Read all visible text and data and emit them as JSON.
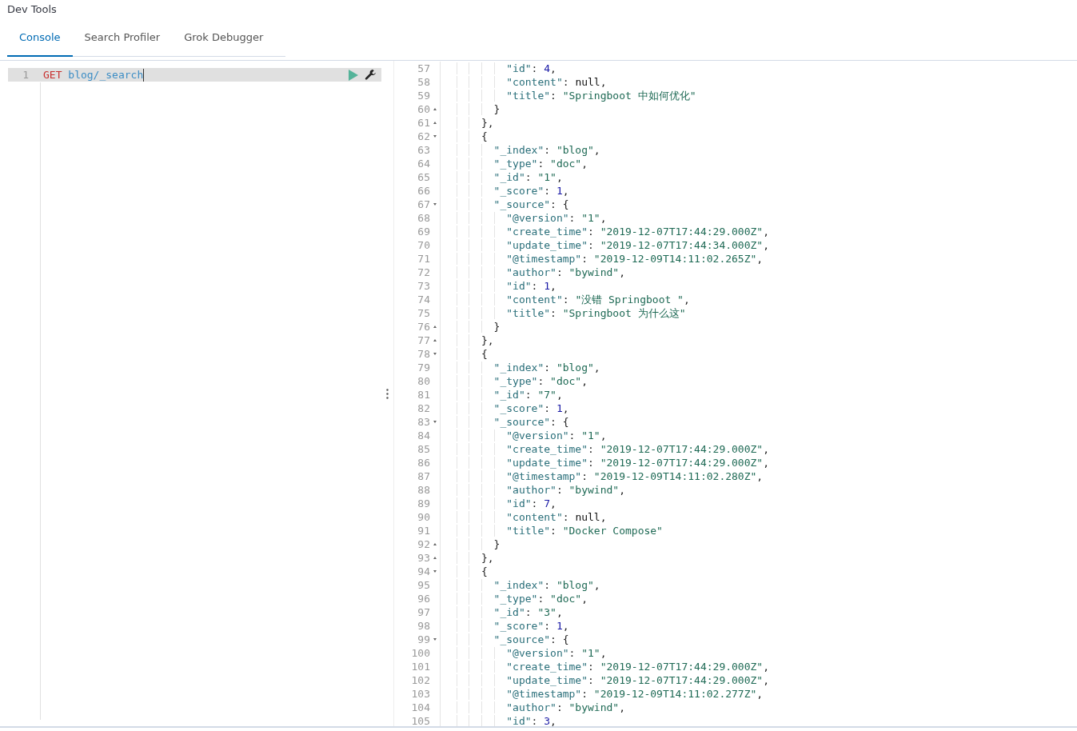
{
  "app": {
    "title": "Dev Tools"
  },
  "tabs": [
    {
      "label": "Console",
      "selected": true
    },
    {
      "label": "Search Profiler",
      "selected": false
    },
    {
      "label": "Grok Debugger",
      "selected": false
    }
  ],
  "request_editor": {
    "lines": [
      {
        "number": "1",
        "highlighted": true,
        "tokens": [
          {
            "kind": "method",
            "text": "GET "
          },
          {
            "kind": "url",
            "text": "blog/_search"
          }
        ]
      }
    ]
  },
  "response_viewer": {
    "lines": [
      {
        "number": "57",
        "kind": "plain",
        "tokens": [
          {
            "kind": "key",
            "text": "          \"id\""
          },
          {
            "kind": "punct",
            "text": ": "
          },
          {
            "kind": "number",
            "text": "4"
          },
          {
            "kind": "punct",
            "text": ","
          }
        ]
      },
      {
        "number": "58",
        "kind": "plain",
        "tokens": [
          {
            "kind": "key",
            "text": "          \"content\""
          },
          {
            "kind": "punct",
            "text": ": "
          },
          {
            "kind": "keyword",
            "text": "null"
          },
          {
            "kind": "punct",
            "text": ","
          }
        ]
      },
      {
        "number": "59",
        "kind": "plain",
        "tokens": [
          {
            "kind": "key",
            "text": "          \"title\""
          },
          {
            "kind": "punct",
            "text": ": "
          },
          {
            "kind": "string",
            "text": "\"Springboot 中如何优化\""
          }
        ]
      },
      {
        "number": "60",
        "kind": "closer",
        "tokens": [
          {
            "kind": "punct",
            "text": "        }"
          }
        ]
      },
      {
        "number": "61",
        "kind": "closer",
        "tokens": [
          {
            "kind": "punct",
            "text": "      },"
          }
        ]
      },
      {
        "number": "62",
        "kind": "opener",
        "tokens": [
          {
            "kind": "punct",
            "text": "      {"
          }
        ]
      },
      {
        "number": "63",
        "kind": "plain",
        "tokens": [
          {
            "kind": "key",
            "text": "        \"_index\""
          },
          {
            "kind": "punct",
            "text": ": "
          },
          {
            "kind": "string",
            "text": "\"blog\""
          },
          {
            "kind": "punct",
            "text": ","
          }
        ]
      },
      {
        "number": "64",
        "kind": "plain",
        "tokens": [
          {
            "kind": "key",
            "text": "        \"_type\""
          },
          {
            "kind": "punct",
            "text": ": "
          },
          {
            "kind": "string",
            "text": "\"doc\""
          },
          {
            "kind": "punct",
            "text": ","
          }
        ]
      },
      {
        "number": "65",
        "kind": "plain",
        "tokens": [
          {
            "kind": "key",
            "text": "        \"_id\""
          },
          {
            "kind": "punct",
            "text": ": "
          },
          {
            "kind": "string",
            "text": "\"1\""
          },
          {
            "kind": "punct",
            "text": ","
          }
        ]
      },
      {
        "number": "66",
        "kind": "plain",
        "tokens": [
          {
            "kind": "key",
            "text": "        \"_score\""
          },
          {
            "kind": "punct",
            "text": ": "
          },
          {
            "kind": "number",
            "text": "1"
          },
          {
            "kind": "punct",
            "text": ","
          }
        ]
      },
      {
        "number": "67",
        "kind": "opener",
        "tokens": [
          {
            "kind": "key",
            "text": "        \"_source\""
          },
          {
            "kind": "punct",
            "text": ": {"
          }
        ]
      },
      {
        "number": "68",
        "kind": "plain",
        "tokens": [
          {
            "kind": "key",
            "text": "          \"@version\""
          },
          {
            "kind": "punct",
            "text": ": "
          },
          {
            "kind": "string",
            "text": "\"1\""
          },
          {
            "kind": "punct",
            "text": ","
          }
        ]
      },
      {
        "number": "69",
        "kind": "plain",
        "tokens": [
          {
            "kind": "key",
            "text": "          \"create_time\""
          },
          {
            "kind": "punct",
            "text": ": "
          },
          {
            "kind": "string",
            "text": "\"2019-12-07T17:44:29.000Z\""
          },
          {
            "kind": "punct",
            "text": ","
          }
        ]
      },
      {
        "number": "70",
        "kind": "plain",
        "tokens": [
          {
            "kind": "key",
            "text": "          \"update_time\""
          },
          {
            "kind": "punct",
            "text": ": "
          },
          {
            "kind": "string",
            "text": "\"2019-12-07T17:44:34.000Z\""
          },
          {
            "kind": "punct",
            "text": ","
          }
        ]
      },
      {
        "number": "71",
        "kind": "plain",
        "tokens": [
          {
            "kind": "key",
            "text": "          \"@timestamp\""
          },
          {
            "kind": "punct",
            "text": ": "
          },
          {
            "kind": "string",
            "text": "\"2019-12-09T14:11:02.265Z\""
          },
          {
            "kind": "punct",
            "text": ","
          }
        ]
      },
      {
        "number": "72",
        "kind": "plain",
        "tokens": [
          {
            "kind": "key",
            "text": "          \"author\""
          },
          {
            "kind": "punct",
            "text": ": "
          },
          {
            "kind": "string",
            "text": "\"bywind\""
          },
          {
            "kind": "punct",
            "text": ","
          }
        ]
      },
      {
        "number": "73",
        "kind": "plain",
        "tokens": [
          {
            "kind": "key",
            "text": "          \"id\""
          },
          {
            "kind": "punct",
            "text": ": "
          },
          {
            "kind": "number",
            "text": "1"
          },
          {
            "kind": "punct",
            "text": ","
          }
        ]
      },
      {
        "number": "74",
        "kind": "plain",
        "tokens": [
          {
            "kind": "key",
            "text": "          \"content\""
          },
          {
            "kind": "punct",
            "text": ": "
          },
          {
            "kind": "string",
            "text": "\"没错 Springboot \""
          },
          {
            "kind": "punct",
            "text": ","
          }
        ]
      },
      {
        "number": "75",
        "kind": "plain",
        "tokens": [
          {
            "kind": "key",
            "text": "          \"title\""
          },
          {
            "kind": "punct",
            "text": ": "
          },
          {
            "kind": "string",
            "text": "\"Springboot 为什么这\""
          }
        ]
      },
      {
        "number": "76",
        "kind": "closer",
        "tokens": [
          {
            "kind": "punct",
            "text": "        }"
          }
        ]
      },
      {
        "number": "77",
        "kind": "closer",
        "tokens": [
          {
            "kind": "punct",
            "text": "      },"
          }
        ]
      },
      {
        "number": "78",
        "kind": "opener",
        "tokens": [
          {
            "kind": "punct",
            "text": "      {"
          }
        ]
      },
      {
        "number": "79",
        "kind": "plain",
        "tokens": [
          {
            "kind": "key",
            "text": "        \"_index\""
          },
          {
            "kind": "punct",
            "text": ": "
          },
          {
            "kind": "string",
            "text": "\"blog\""
          },
          {
            "kind": "punct",
            "text": ","
          }
        ]
      },
      {
        "number": "80",
        "kind": "plain",
        "tokens": [
          {
            "kind": "key",
            "text": "        \"_type\""
          },
          {
            "kind": "punct",
            "text": ": "
          },
          {
            "kind": "string",
            "text": "\"doc\""
          },
          {
            "kind": "punct",
            "text": ","
          }
        ]
      },
      {
        "number": "81",
        "kind": "plain",
        "tokens": [
          {
            "kind": "key",
            "text": "        \"_id\""
          },
          {
            "kind": "punct",
            "text": ": "
          },
          {
            "kind": "string",
            "text": "\"7\""
          },
          {
            "kind": "punct",
            "text": ","
          }
        ]
      },
      {
        "number": "82",
        "kind": "plain",
        "tokens": [
          {
            "kind": "key",
            "text": "        \"_score\""
          },
          {
            "kind": "punct",
            "text": ": "
          },
          {
            "kind": "number",
            "text": "1"
          },
          {
            "kind": "punct",
            "text": ","
          }
        ]
      },
      {
        "number": "83",
        "kind": "opener",
        "tokens": [
          {
            "kind": "key",
            "text": "        \"_source\""
          },
          {
            "kind": "punct",
            "text": ": {"
          }
        ]
      },
      {
        "number": "84",
        "kind": "plain",
        "tokens": [
          {
            "kind": "key",
            "text": "          \"@version\""
          },
          {
            "kind": "punct",
            "text": ": "
          },
          {
            "kind": "string",
            "text": "\"1\""
          },
          {
            "kind": "punct",
            "text": ","
          }
        ]
      },
      {
        "number": "85",
        "kind": "plain",
        "tokens": [
          {
            "kind": "key",
            "text": "          \"create_time\""
          },
          {
            "kind": "punct",
            "text": ": "
          },
          {
            "kind": "string",
            "text": "\"2019-12-07T17:44:29.000Z\""
          },
          {
            "kind": "punct",
            "text": ","
          }
        ]
      },
      {
        "number": "86",
        "kind": "plain",
        "tokens": [
          {
            "kind": "key",
            "text": "          \"update_time\""
          },
          {
            "kind": "punct",
            "text": ": "
          },
          {
            "kind": "string",
            "text": "\"2019-12-07T17:44:29.000Z\""
          },
          {
            "kind": "punct",
            "text": ","
          }
        ]
      },
      {
        "number": "87",
        "kind": "plain",
        "tokens": [
          {
            "kind": "key",
            "text": "          \"@timestamp\""
          },
          {
            "kind": "punct",
            "text": ": "
          },
          {
            "kind": "string",
            "text": "\"2019-12-09T14:11:02.280Z\""
          },
          {
            "kind": "punct",
            "text": ","
          }
        ]
      },
      {
        "number": "88",
        "kind": "plain",
        "tokens": [
          {
            "kind": "key",
            "text": "          \"author\""
          },
          {
            "kind": "punct",
            "text": ": "
          },
          {
            "kind": "string",
            "text": "\"bywind\""
          },
          {
            "kind": "punct",
            "text": ","
          }
        ]
      },
      {
        "number": "89",
        "kind": "plain",
        "tokens": [
          {
            "kind": "key",
            "text": "          \"id\""
          },
          {
            "kind": "punct",
            "text": ": "
          },
          {
            "kind": "number",
            "text": "7"
          },
          {
            "kind": "punct",
            "text": ","
          }
        ]
      },
      {
        "number": "90",
        "kind": "plain",
        "tokens": [
          {
            "kind": "key",
            "text": "          \"content\""
          },
          {
            "kind": "punct",
            "text": ": "
          },
          {
            "kind": "keyword",
            "text": "null"
          },
          {
            "kind": "punct",
            "text": ","
          }
        ]
      },
      {
        "number": "91",
        "kind": "plain",
        "tokens": [
          {
            "kind": "key",
            "text": "          \"title\""
          },
          {
            "kind": "punct",
            "text": ": "
          },
          {
            "kind": "string",
            "text": "\"Docker Compose\""
          }
        ]
      },
      {
        "number": "92",
        "kind": "closer",
        "tokens": [
          {
            "kind": "punct",
            "text": "        }"
          }
        ]
      },
      {
        "number": "93",
        "kind": "closer",
        "tokens": [
          {
            "kind": "punct",
            "text": "      },"
          }
        ]
      },
      {
        "number": "94",
        "kind": "opener",
        "tokens": [
          {
            "kind": "punct",
            "text": "      {"
          }
        ]
      },
      {
        "number": "95",
        "kind": "plain",
        "tokens": [
          {
            "kind": "key",
            "text": "        \"_index\""
          },
          {
            "kind": "punct",
            "text": ": "
          },
          {
            "kind": "string",
            "text": "\"blog\""
          },
          {
            "kind": "punct",
            "text": ","
          }
        ]
      },
      {
        "number": "96",
        "kind": "plain",
        "tokens": [
          {
            "kind": "key",
            "text": "        \"_type\""
          },
          {
            "kind": "punct",
            "text": ": "
          },
          {
            "kind": "string",
            "text": "\"doc\""
          },
          {
            "kind": "punct",
            "text": ","
          }
        ]
      },
      {
        "number": "97",
        "kind": "plain",
        "tokens": [
          {
            "kind": "key",
            "text": "        \"_id\""
          },
          {
            "kind": "punct",
            "text": ": "
          },
          {
            "kind": "string",
            "text": "\"3\""
          },
          {
            "kind": "punct",
            "text": ","
          }
        ]
      },
      {
        "number": "98",
        "kind": "plain",
        "tokens": [
          {
            "kind": "key",
            "text": "        \"_score\""
          },
          {
            "kind": "punct",
            "text": ": "
          },
          {
            "kind": "number",
            "text": "1"
          },
          {
            "kind": "punct",
            "text": ","
          }
        ]
      },
      {
        "number": "99",
        "kind": "opener",
        "tokens": [
          {
            "kind": "key",
            "text": "        \"_source\""
          },
          {
            "kind": "punct",
            "text": ": {"
          }
        ]
      },
      {
        "number": "100",
        "kind": "plain",
        "tokens": [
          {
            "kind": "key",
            "text": "          \"@version\""
          },
          {
            "kind": "punct",
            "text": ": "
          },
          {
            "kind": "string",
            "text": "\"1\""
          },
          {
            "kind": "punct",
            "text": ","
          }
        ]
      },
      {
        "number": "101",
        "kind": "plain",
        "tokens": [
          {
            "kind": "key",
            "text": "          \"create_time\""
          },
          {
            "kind": "punct",
            "text": ": "
          },
          {
            "kind": "string",
            "text": "\"2019-12-07T17:44:29.000Z\""
          },
          {
            "kind": "punct",
            "text": ","
          }
        ]
      },
      {
        "number": "102",
        "kind": "plain",
        "tokens": [
          {
            "kind": "key",
            "text": "          \"update_time\""
          },
          {
            "kind": "punct",
            "text": ": "
          },
          {
            "kind": "string",
            "text": "\"2019-12-07T17:44:29.000Z\""
          },
          {
            "kind": "punct",
            "text": ","
          }
        ]
      },
      {
        "number": "103",
        "kind": "plain",
        "tokens": [
          {
            "kind": "key",
            "text": "          \"@timestamp\""
          },
          {
            "kind": "punct",
            "text": ": "
          },
          {
            "kind": "string",
            "text": "\"2019-12-09T14:11:02.277Z\""
          },
          {
            "kind": "punct",
            "text": ","
          }
        ]
      },
      {
        "number": "104",
        "kind": "plain",
        "tokens": [
          {
            "kind": "key",
            "text": "          \"author\""
          },
          {
            "kind": "punct",
            "text": ": "
          },
          {
            "kind": "string",
            "text": "\"bywind\""
          },
          {
            "kind": "punct",
            "text": ","
          }
        ]
      },
      {
        "number": "105",
        "kind": "plain",
        "tokens": [
          {
            "kind": "key",
            "text": "          \"id\""
          },
          {
            "kind": "punct",
            "text": ": "
          },
          {
            "kind": "number",
            "text": "3"
          },
          {
            "kind": "punct",
            "text": ","
          }
        ]
      }
    ]
  }
}
